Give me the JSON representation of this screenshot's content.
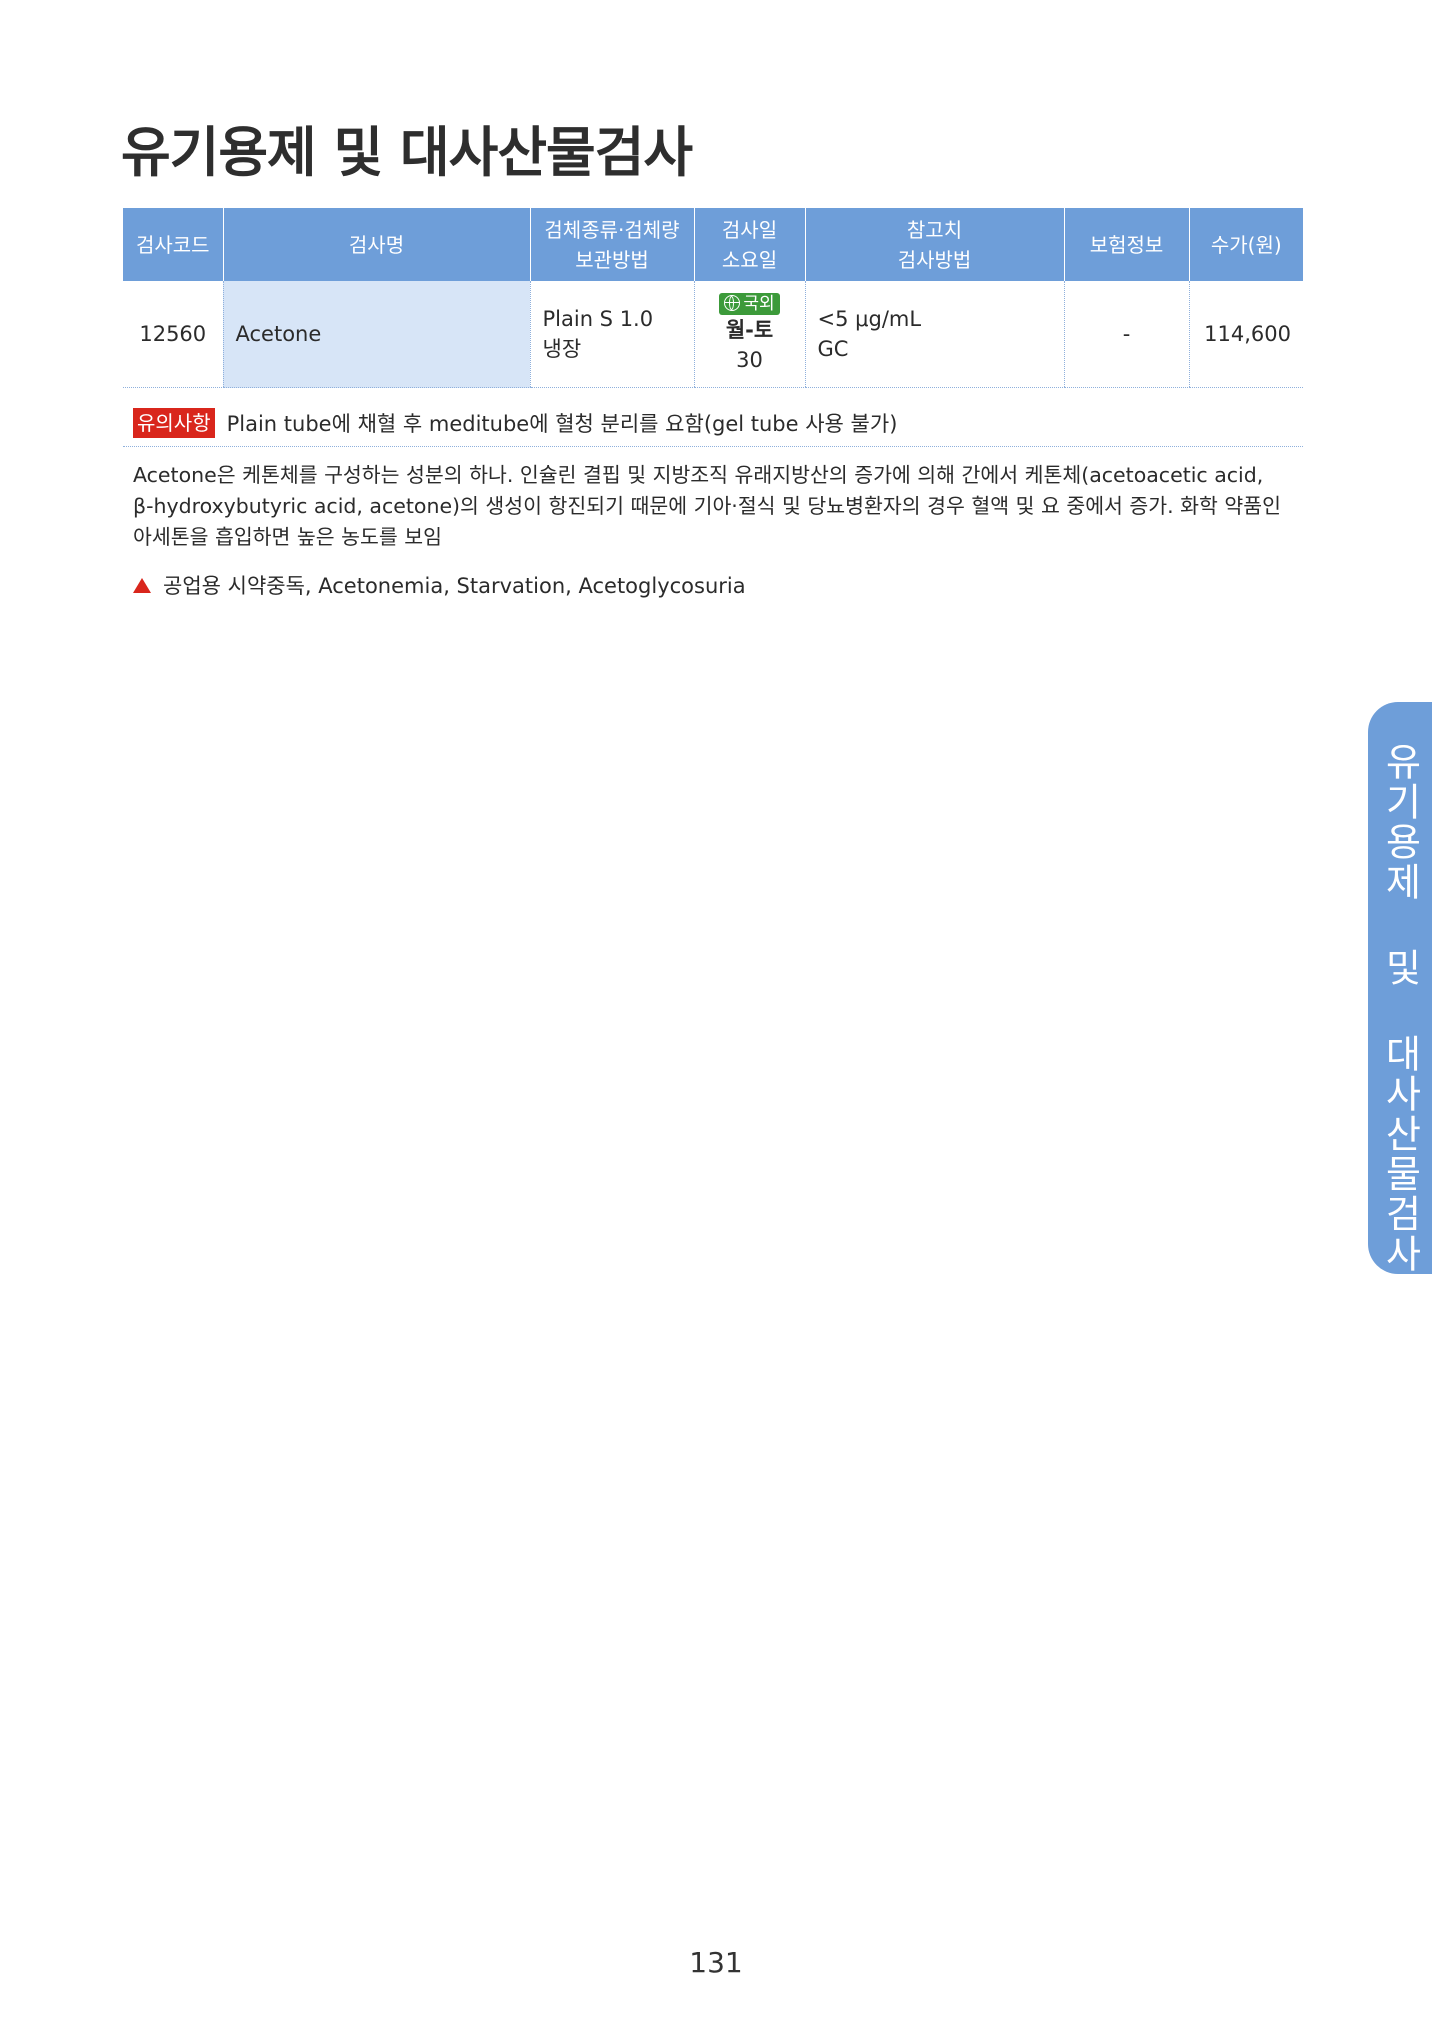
{
  "page": {
    "title": "유기용제 및 대사산물검사",
    "side_tab": "유기용제 및 대사산물검사",
    "page_number": "131"
  },
  "table": {
    "headers": {
      "code": "검사코드",
      "name": "검사명",
      "specimen_1": "검체종류·검체량",
      "specimen_2": "보관방법",
      "tat_1": "검사일",
      "tat_2": "소요일",
      "ref_1": "참고치",
      "ref_2": "검사방법",
      "insurance": "보험정보",
      "fee": "수가(원)"
    },
    "row": {
      "code": "12560",
      "name": "Acetone",
      "specimen": "Plain S 1.0",
      "storage": "냉장",
      "badge": "국외",
      "test_days": "월-토",
      "tat": "30",
      "reference": "<5 μg/mL",
      "method": "GC",
      "insurance": "-",
      "fee": "114,600"
    }
  },
  "note": {
    "tag": "유의사항",
    "text": "Plain tube에 채혈 후 meditube에 혈청 분리를 요함(gel tube 사용 불가)"
  },
  "description": {
    "line1": "Acetone은 케톤체를 구성하는 성분의 하나. 인슐린 결핍 및 지방조직 유래지방산의 증가에 의해 간에서 케톤체(acetoacetic acid,",
    "line2": "β-hydroxybutyric acid, acetone)의 생성이 항진되기 때문에 기아·절식 및 당뇨병환자의 경우 혈액 및 요 중에서 증가. 화학 약품인",
    "line3": "아세톤을 흡입하면 높은 농도를 보임"
  },
  "related": {
    "text": "공업용 시약중독, Acetonemia, Starvation, Acetoglycosuria"
  },
  "colors": {
    "header_blue": "#6e9ed9",
    "name_cell_blue": "#d7e5f7",
    "alert_red": "#d9261c",
    "badge_green": "#3c9a3a"
  },
  "icons": {
    "badge_icon": "globe-icon",
    "related_icon": "red-triangle-icon"
  }
}
